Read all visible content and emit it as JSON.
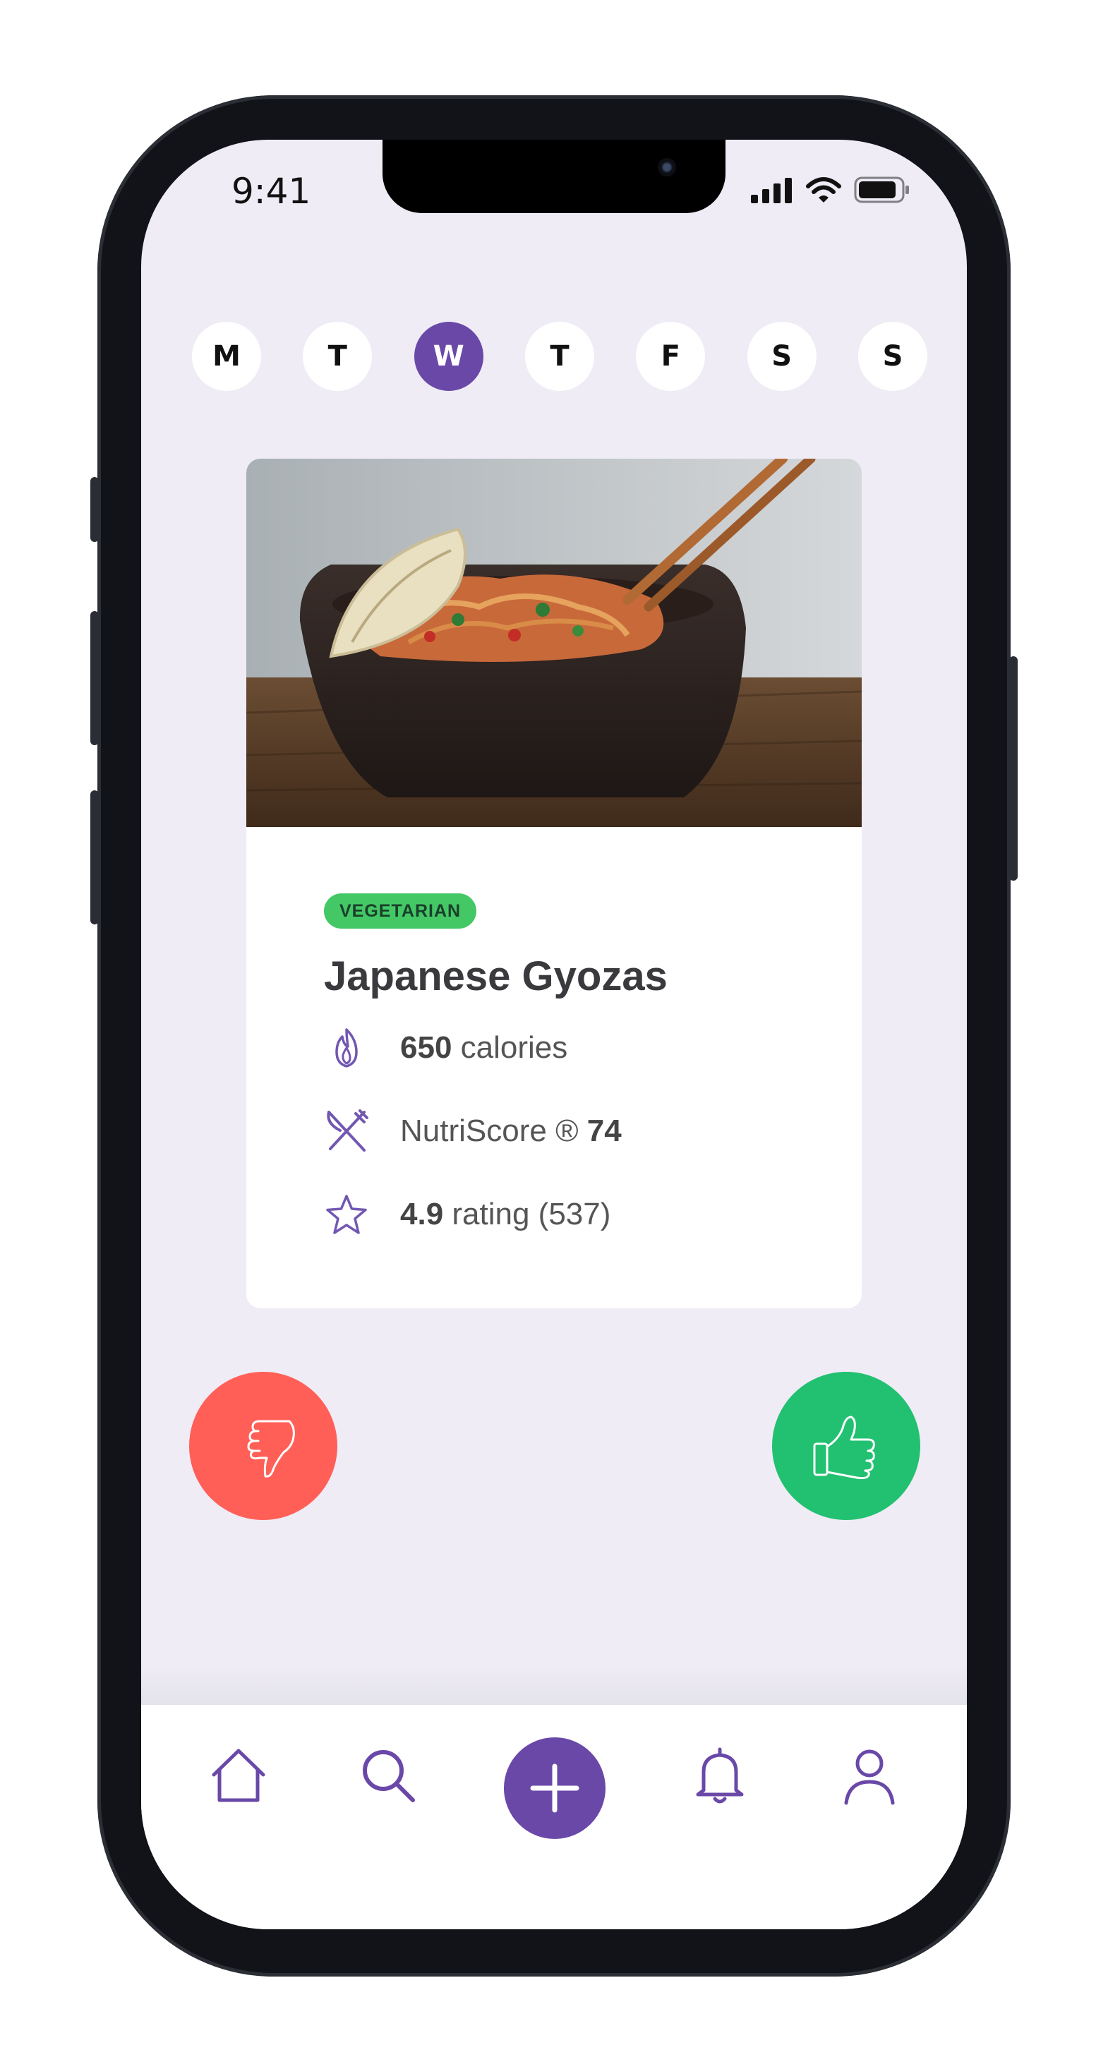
{
  "status_bar": {
    "time": "9:41"
  },
  "days": [
    "M",
    "T",
    "W",
    "T",
    "F",
    "S",
    "S"
  ],
  "selected_day_index": 2,
  "recipe": {
    "badge": "VEGETARIAN",
    "title": "Japanese Gyozas",
    "calories_value": "650",
    "calories_label": " calories",
    "nutriscore_label": "NutriScore ® ",
    "nutriscore_value": "74",
    "rating_value": "4.9",
    "rating_label": " rating (537)"
  },
  "colors": {
    "accent": "#6a48a8",
    "dislike": "#ff5f57",
    "like": "#22c071",
    "badge": "#44c866",
    "background": "#efecf6"
  },
  "icons": {
    "calories": "flame-icon",
    "nutriscore": "utensils-icon",
    "rating": "star-icon",
    "dislike": "thumbs-down-icon",
    "like": "thumbs-up-icon",
    "nav": [
      "home-icon",
      "search-icon",
      "plus-icon",
      "bell-icon",
      "user-icon"
    ]
  }
}
